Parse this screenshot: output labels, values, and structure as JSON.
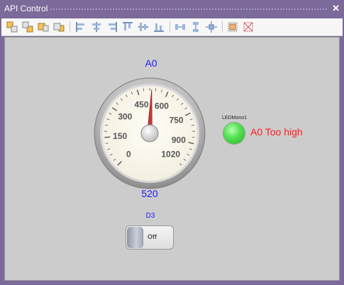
{
  "window": {
    "title": "API Control",
    "close_label": "✕"
  },
  "toolbar": {
    "buttons": [
      {
        "name": "bring-to-front-icon"
      },
      {
        "name": "send-to-back-icon"
      },
      {
        "name": "bring-forward-icon"
      },
      {
        "name": "send-backward-icon"
      },
      {
        "name": "align-left-icon"
      },
      {
        "name": "align-center-icon"
      },
      {
        "name": "align-right-icon"
      },
      {
        "name": "align-top-icon"
      },
      {
        "name": "align-middle-icon"
      },
      {
        "name": "align-bottom-icon"
      },
      {
        "name": "space-horizontal-icon"
      },
      {
        "name": "space-vertical-icon"
      },
      {
        "name": "center-in-form-icon"
      },
      {
        "name": "size-to-grid-icon"
      },
      {
        "name": "snap-to-grid-icon"
      }
    ]
  },
  "gauge": {
    "title": "A0",
    "value_text": "520",
    "value": 520,
    "min": 0,
    "max": 1020,
    "tick_labels": [
      "0",
      "150",
      "300",
      "450",
      "600",
      "750",
      "900",
      "1020"
    ]
  },
  "led": {
    "caption": "LEDMono1",
    "text": "A0 Too high",
    "color": "#44dd44"
  },
  "switch": {
    "title": "D3",
    "state_label": "Off"
  }
}
